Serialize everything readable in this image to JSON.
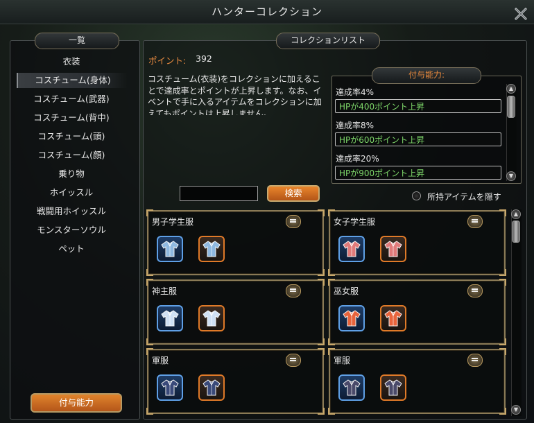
{
  "window": {
    "title": "ハンターコレクション"
  },
  "left_panel": {
    "header": "一覧",
    "categories": [
      "衣装",
      "コスチューム(身体)",
      "コスチューム(武器)",
      "コスチューム(背中)",
      "コスチューム(頭)",
      "コスチューム(顔)",
      "乗り物",
      "ホイッスル",
      "戦闘用ホイッスル",
      "モンスターソウル",
      "ペット"
    ],
    "selected_index": 1,
    "bonus_button": "付与能力"
  },
  "right_panel": {
    "header": "コレクションリスト",
    "points_label": "ポイント:",
    "points_value": "392",
    "description": "コスチューム(衣装)をコレクションに加えることで達成率とポイントが上昇します。なお、イベントで手に入るアイテムをコレクションに加えてもポイントは上昇しません。"
  },
  "bonus": {
    "header": "付与能力:",
    "entries": [
      {
        "rate": "達成率4%",
        "effect": "HPが400ポイント上昇"
      },
      {
        "rate": "達成率8%",
        "effect": "HPが600ポイント上昇"
      },
      {
        "rate": "達成率20%",
        "effect": "HPが900ポイント上昇"
      }
    ]
  },
  "search": {
    "value": "",
    "button": "検索"
  },
  "hide_owned": {
    "label": "所持アイテムを隠す",
    "checked": false
  },
  "collections": [
    {
      "name": "男子学生服",
      "icon": "school-uniform-male-icon",
      "tint": "#8fb8e0"
    },
    {
      "name": "女子学生服",
      "icon": "school-uniform-female-icon",
      "tint": "#e07a7a"
    },
    {
      "name": "神主服",
      "icon": "shinto-priest-robe-icon",
      "tint": "#cfe0f4"
    },
    {
      "name": "巫女服",
      "icon": "shrine-maiden-robe-icon",
      "tint": "#e8643c"
    },
    {
      "name": "軍服",
      "icon": "military-uniform-icon",
      "tint": "#3a4a7a"
    },
    {
      "name": "軍服",
      "icon": "military-uniform-icon",
      "tint": "#4a4a6a"
    }
  ],
  "colors": {
    "accent_orange": "#e0842c",
    "effect_green": "#7ed86a",
    "frame_gold": "#8a7a56"
  }
}
